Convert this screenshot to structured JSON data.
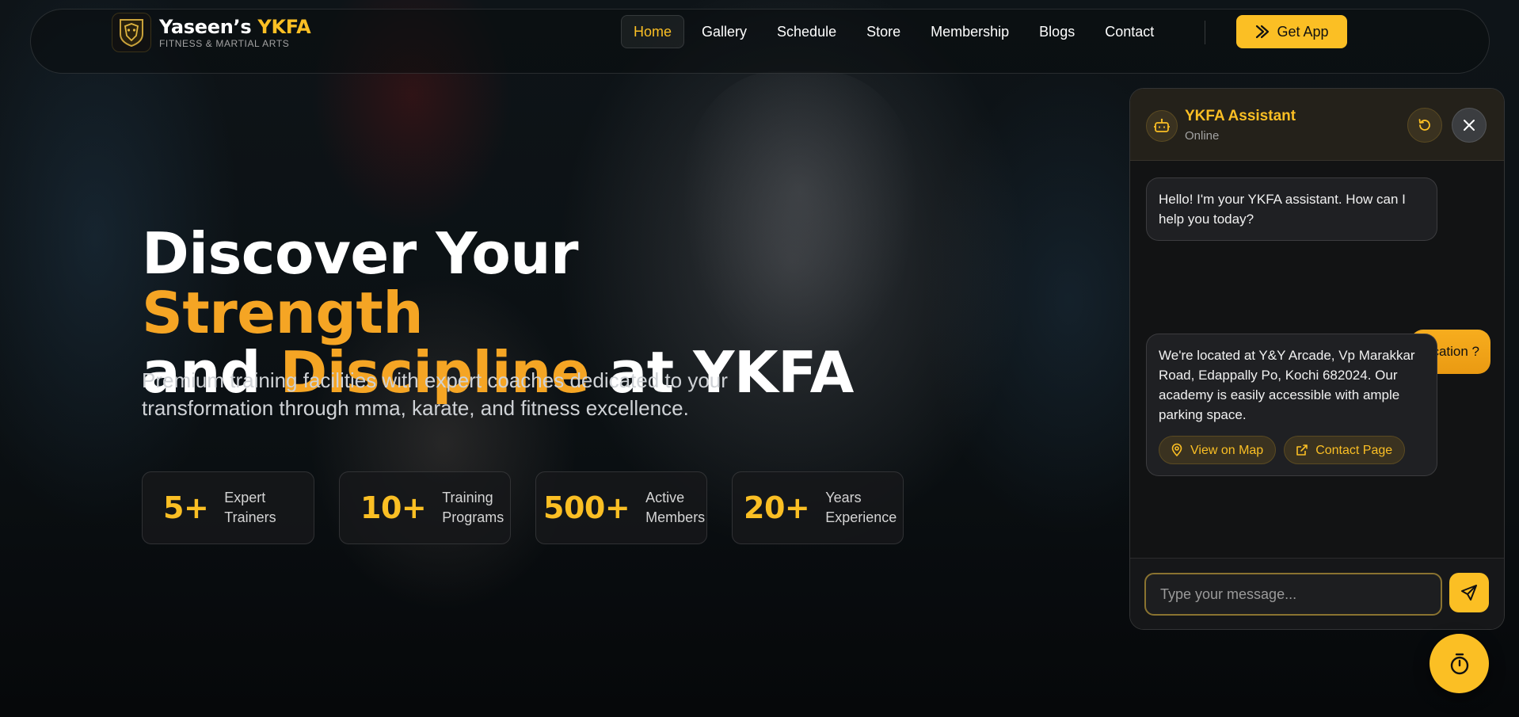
{
  "brand": {
    "name_main": "Yaseen’s ",
    "name_accent": "YKFA",
    "tagline": "FITNESS & MARTIAL ARTS",
    "accent_color": "#fbbf24"
  },
  "nav": {
    "links": [
      {
        "label": "Home",
        "active": true
      },
      {
        "label": "Gallery",
        "active": false
      },
      {
        "label": "Schedule",
        "active": false
      },
      {
        "label": "Store",
        "active": false
      },
      {
        "label": "Membership",
        "active": false
      },
      {
        "label": "Blogs",
        "active": false
      },
      {
        "label": "Contact",
        "active": false
      }
    ],
    "cta": {
      "label": "Get App",
      "icon": "arrow-right-icon"
    }
  },
  "hero": {
    "title_part1": "Discover Your ",
    "title_accent1": "Strength",
    "title_part2": "and ",
    "title_accent2": "Discipline",
    "title_part3": " at YKFA",
    "subtitle": "Premium training facilities with expert coaches dedicated to your transformation through mma, karate, and fitness excellence.",
    "stats": [
      {
        "value": "5+",
        "label": "Expert Trainers"
      },
      {
        "value": "10+",
        "label": "Training Programs"
      },
      {
        "value": "500+",
        "label": "Active Members"
      },
      {
        "value": "20+",
        "label": "Years Experience"
      }
    ]
  },
  "chat": {
    "title": "YKFA Assistant",
    "status": "Online",
    "messages": [
      {
        "from": "bot",
        "text": "Hello! I'm your YKFA assistant. How can I help you today?"
      },
      {
        "from": "user",
        "text": "location ?"
      },
      {
        "from": "bot",
        "text": "We're located at Y&Y Arcade, Vp Marakkar Road, Edappally Po, Kochi 682024. Our academy is easily accessible with ample parking space."
      }
    ],
    "actions": [
      {
        "label": "View on Map",
        "icon": "map-pin-icon"
      },
      {
        "label": "Contact Page",
        "icon": "external-link-icon"
      }
    ],
    "input_placeholder": "Type your message...",
    "input_value": ""
  },
  "colors": {
    "accent": "#fbbf24",
    "accent_orange": "#f5a524",
    "background": "#0b1013"
  }
}
